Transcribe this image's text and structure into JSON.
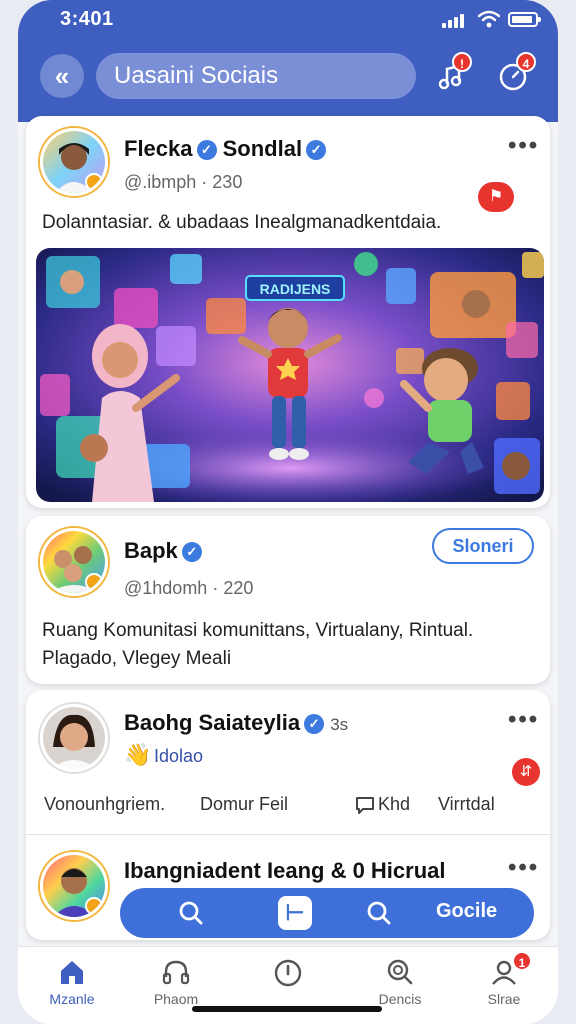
{
  "status_bar": {
    "time": "3:401"
  },
  "header": {
    "search_text": "Uasaini Sociais",
    "music_badge": "!",
    "timer_badge": "4"
  },
  "posts": [
    {
      "name": "Flecka",
      "name_second": "Sondlal",
      "handle": "@.ibmph · 230",
      "text": "Dolanntasiar. & ubadaas Inealgmanadkentdaia.",
      "image_banner": "RADIJENS"
    },
    {
      "name": "Bapk",
      "handle": "@1hdomh · 220",
      "follow_label": "Sloneri",
      "text_line1": "Ruang Komunitasi komunittans, Virtualany, Rintual.",
      "text_line2": "Plagado, Vlegey Meali"
    },
    {
      "name": "Baohg Saiateylia",
      "meta": "3s",
      "sub_label": "Idolao",
      "action_1": "Vonounhgriem.",
      "action_2": "Domur Feil",
      "action_3": "Khd",
      "action_4": "Virrtdal"
    },
    {
      "name": "Ibangniadent Ieang & 0 Hicrual"
    }
  ],
  "floating_bar": {
    "label": "Gocile"
  },
  "bottom_nav": {
    "items": [
      {
        "label": "Mzanle"
      },
      {
        "label": "Phaom"
      },
      {
        "label": ""
      },
      {
        "label": "Dencis"
      },
      {
        "label": "Slrae"
      }
    ],
    "profile_badge": "1"
  },
  "colors": {
    "header": "#3e5ec0",
    "accent": "#3d7ae0",
    "badge": "#e8342f"
  }
}
